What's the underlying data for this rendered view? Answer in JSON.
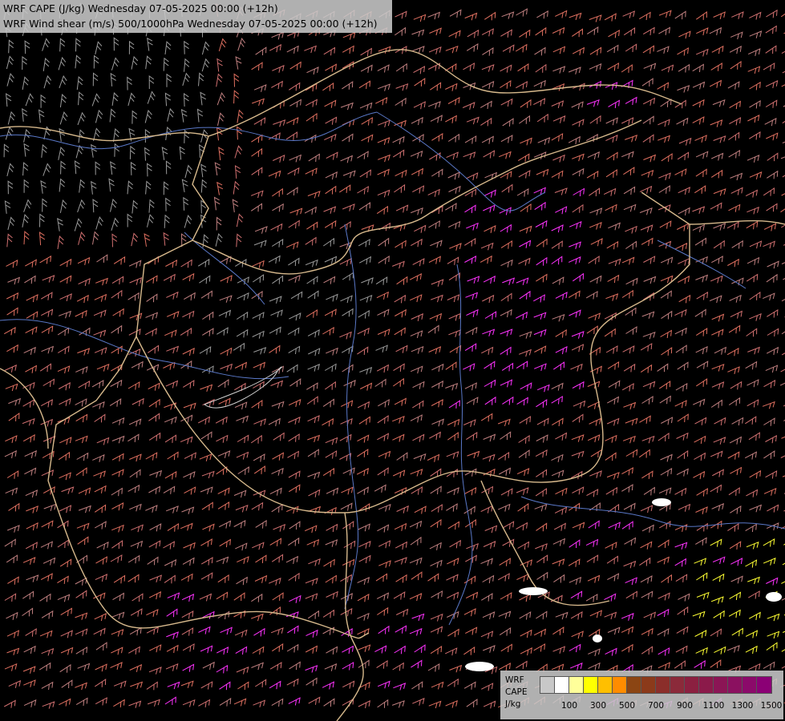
{
  "header": {
    "line1": "WRF CAPE (J/kg) Wednesday 07-05-2025 00:00 (+12h)",
    "line2": "WRF Wind shear (m/s) 500/1000hPa Wednesday 07-05-2025 00:00 (+12h)"
  },
  "legend": {
    "label_model": "WRF",
    "label_var": "CAPE",
    "label_unit": "J/kg",
    "colors": [
      "#c8c8c8",
      "#ffffff",
      "#ffff9a",
      "#ffff00",
      "#ffbf00",
      "#ff8c00",
      "#8b4513",
      "#8b3a1a",
      "#8b2e2a",
      "#8b2a3a",
      "#8b2040",
      "#8b1a4a",
      "#8b1555",
      "#8b1060",
      "#8b0a6a",
      "#8b0075"
    ],
    "tick_labels": [
      "100",
      "300",
      "500",
      "700",
      "900",
      "1100",
      "1300",
      "1500"
    ]
  },
  "map": {
    "background": "#000000",
    "border_color": "#d7b98c",
    "river_color": "#5a78c8",
    "barb_colors": [
      "#9a9a9a",
      "#c08080",
      "#d07070",
      "#e07060",
      "#ff33ff",
      "#ffff33",
      "#ffffff"
    ]
  }
}
